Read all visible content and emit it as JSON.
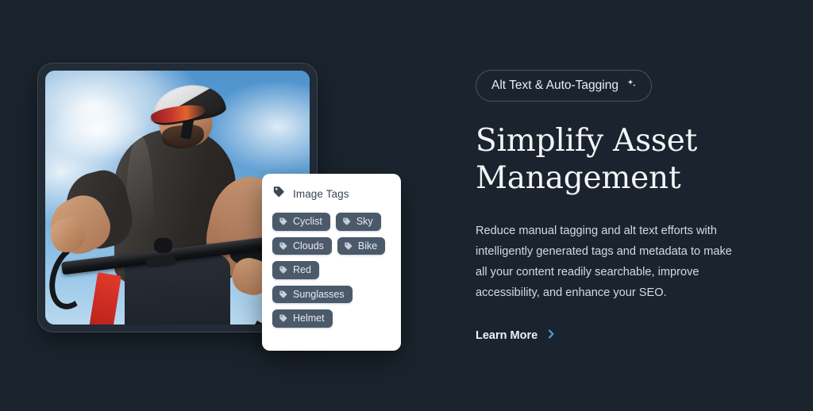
{
  "theme": {
    "background": "#1b242e",
    "accent_blue": "#4aa8e8",
    "card_background": "#ffffff",
    "pill_background": "#4b5a6b",
    "badge_border": "#3e5668",
    "heading_color": "#f3f6f8",
    "body_color": "#d3dae1"
  },
  "badge": {
    "label": "Alt Text & Auto-Tagging",
    "icon": "sparkle-icon"
  },
  "headline": "Simplify Asset Management",
  "body": "Reduce manual tagging and alt text efforts with intelligently generated tags and metadata to make all your content readily searchable, improve accessibility, and enhance your SEO.",
  "cta": {
    "label": "Learn More",
    "icon": "chevron-right-icon"
  },
  "tags_card": {
    "title": "Image Tags",
    "title_icon": "tag-icon",
    "tags": [
      "Cyclist",
      "Sky",
      "Clouds",
      "Bike",
      "Red",
      "Sunglasses",
      "Helmet"
    ]
  },
  "device_preview": {
    "alt": "Cyclist riding a road bike with a helmet and red sunglasses against a blue sky with clouds"
  }
}
